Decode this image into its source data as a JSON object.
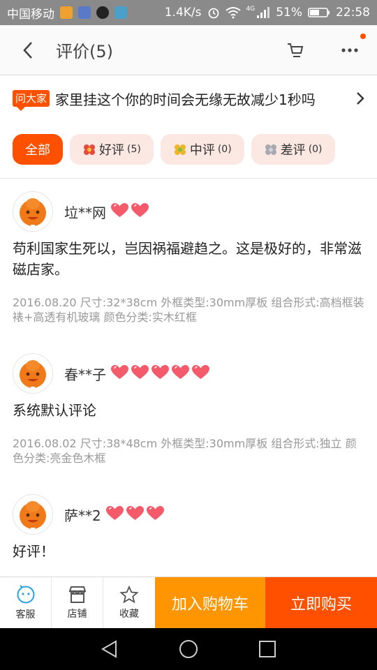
{
  "statusbar": {
    "carrier": "中国移动",
    "speed": "1.4K/s",
    "network": "4G",
    "battery": "51%",
    "time": "22:58"
  },
  "topbar": {
    "title": "评价(5)"
  },
  "ask": {
    "badge": "问大家",
    "question": "家里挂这个你的时间会无缘无故减少1秒吗"
  },
  "filters": [
    {
      "label": "全部",
      "count": ""
    },
    {
      "label": "好评",
      "count": "(5)"
    },
    {
      "label": "中评",
      "count": "(0)"
    },
    {
      "label": "差评",
      "count": "(0)"
    }
  ],
  "reviews": [
    {
      "nick": "垃**网",
      "hearts": 2,
      "body": "苟利国家生死以，岂因祸福避趋之。这是极好的，非常滋磁店家。",
      "meta": "2016.08.20 尺寸:32*38cm  外框类型:30mm厚板  组合形式:高档框装裱+高透有机玻璃  颜色分类:实木红框"
    },
    {
      "nick": "春**子",
      "hearts": 5,
      "body": "系统默认评论",
      "meta": "2016.08.02 尺寸:38*48cm  外框类型:30mm厚板  组合形式:独立  颜色分类:亮金色木框"
    },
    {
      "nick": "萨**2",
      "hearts": 3,
      "body": "好评！",
      "meta": ""
    }
  ],
  "bottombar": {
    "service": "客服",
    "shop": "店铺",
    "favorite": "收藏",
    "add_cart": "加入购物车",
    "buy_now": "立即购买"
  },
  "colors": {
    "accent": "#ff5000",
    "secondary": "#ff9500",
    "heart": "#f45a6a"
  }
}
